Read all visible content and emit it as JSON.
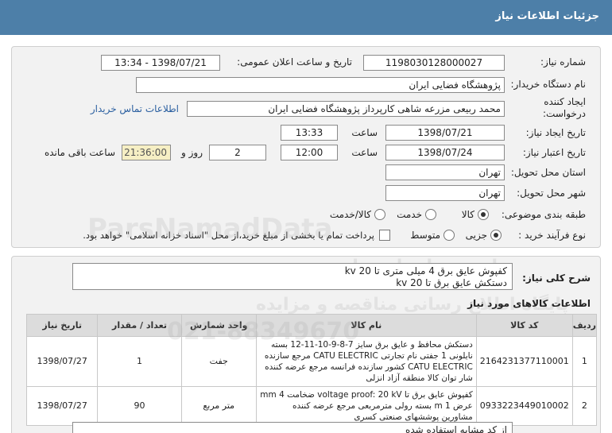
{
  "header": {
    "title": "جزئیات اطلاعات نیاز"
  },
  "form": {
    "need_number_label": "شماره نیاز:",
    "need_number": "1198030128000027",
    "announce_label": "تاریخ و ساعت اعلان عمومی:",
    "announce_value": "1398/07/21 - 13:34",
    "buyer_label": "نام دستگاه خریدار:",
    "buyer_value": "پژوهشگاه فضایی ایران",
    "creator_label_1": "ایجاد کننده",
    "creator_label_2": "درخواست:",
    "creator_value": "محمد  ربیعی مزرعه شاهی کارپرداز پژوهشگاه فضایی ایران",
    "contact_link": "اطلاعات تماس خریدار",
    "create_date_label": "تاریخ ایجاد نیاز:",
    "create_date": "1398/07/21",
    "time_label": "ساعت",
    "create_time": "13:33",
    "validity_label": "تاریخ اعتبار نیاز:",
    "validity_date": "1398/07/24",
    "validity_time": "12:00",
    "days_value": "2",
    "days_label": "روز و",
    "remaining_time": "21:36:00",
    "remaining_label": "ساعت باقی مانده",
    "province_label": "استان محل تحویل:",
    "province_value": "تهران",
    "city_label": "شهر محل تحویل:",
    "city_value": "تهران",
    "category_label": "طبقه بندی موضوعی:",
    "category_options": [
      "کالا",
      "خدمت",
      "کالا/خدمت"
    ],
    "process_label": "نوع فرآیند خرید :",
    "process_options": [
      "جزیی",
      "متوسط"
    ],
    "payment_text": "پرداخت تمام یا بخشی از مبلغ خرید،از محل \"اسناد خزانه اسلامی\" خواهد بود."
  },
  "summary": {
    "label": "شرح کلی نیاز:",
    "line1": "کفپوش عایق برق 4 میلی متری تا 20 kv",
    "line2": "دستکش عایق برق تا 20 kv"
  },
  "items_section": {
    "title": "اطلاعات کالاهای مورد نیاز",
    "headers": [
      "ردیف",
      "کد کالا",
      "نام کالا",
      "واحد شمارش",
      "تعداد / مقدار",
      "تاریخ نیاز"
    ],
    "rows": [
      {
        "row": "1",
        "code": "2164231377110001",
        "name_lines": [
          "دستکش محافظ و عایق برق سایز 7-8-9-10-11-12 بسته",
          "نایلونی 1 جفتی نام تجارتی CATU ELECTRIC مرجع سازنده",
          "CATU ELECTRIC کشور سازنده فرانسه مرجع عرضه کننده",
          "شار توان کالا منطقه آزاد انزلی"
        ],
        "unit": "جفت",
        "qty": "1",
        "date": "1398/07/27"
      },
      {
        "row": "2",
        "code": "0933223449010002",
        "name_lines": [
          "کفپوش عایق برق تا voltage proof: 20 kV ضخامت 4 mm",
          "عرض 1 m بسته رولی مترمربعی مرجع عرضه کننده",
          "مشاورین پوششهای صنعتی کسری"
        ],
        "unit": "متر مربع",
        "qty": "90",
        "date": "1398/07/27"
      }
    ]
  },
  "footer_note": "از کد مشابه استفاده شده",
  "watermarks": [
    "پارس نماد داده ها",
    "پایگاه اطلاع رسانی مناقصه و مزایده",
    "ParsNamadData",
    "021-88349670"
  ]
}
